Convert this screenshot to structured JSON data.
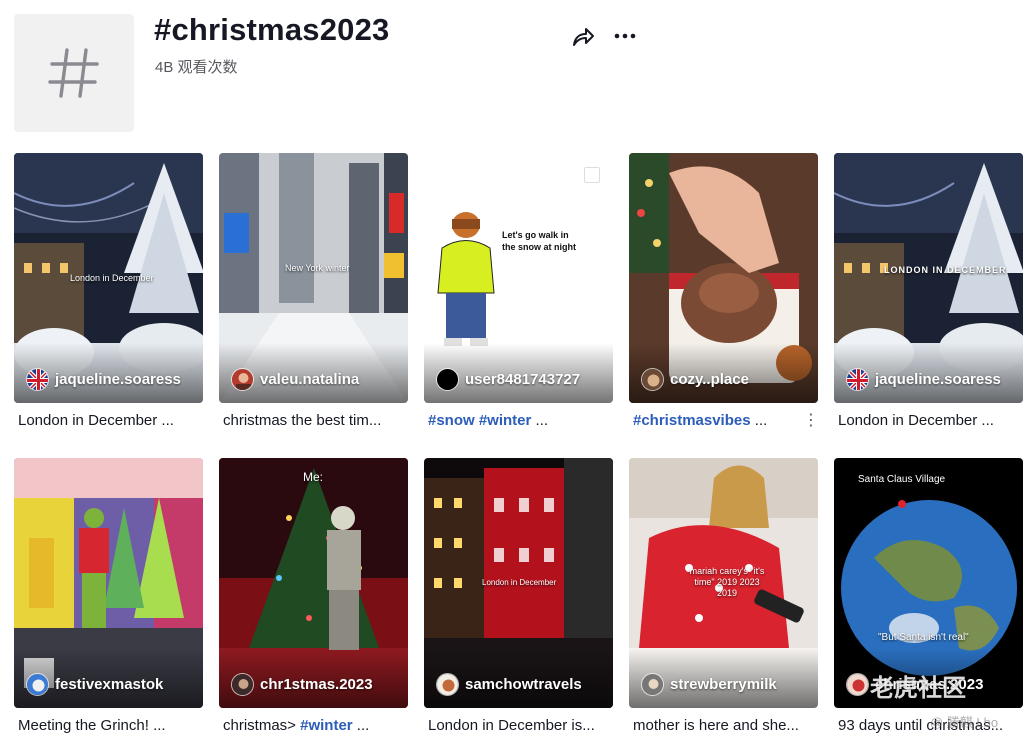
{
  "hashtag": {
    "title": "#christmas2023",
    "views": "4B 观看次数"
  },
  "videos": [
    {
      "author": "jaqueline.soaress",
      "caption": "London in December ...",
      "overlay": "London in December",
      "avatar": "uk-flag-icon"
    },
    {
      "author": "valeu.natalina",
      "caption": "christmas the best tim...",
      "overlay": "New York winter",
      "avatar": "avatar-icon"
    },
    {
      "author": "user8481743727",
      "caption_tags": "#snow #winter",
      "caption_rest": " ...",
      "overlay": "Let's go walk in the snow at night",
      "avatar": "avatar-icon"
    },
    {
      "author": "cozy..place",
      "caption_tags": "#christmasvibes",
      "caption_rest": " ...",
      "avatar": "avatar-icon"
    },
    {
      "author": "jaqueline.soaress",
      "caption": "London in December ...",
      "overlay": "LONDON IN DECEMBER",
      "avatar": "uk-flag-icon"
    },
    {
      "author": "festivexmastok",
      "caption": "Meeting the Grinch! ...",
      "avatar": "avatar-icon"
    },
    {
      "author": "chr1stmas.2023",
      "caption_pre": "christmas> ",
      "caption_tags": "#winter",
      "caption_rest": " ...",
      "overlay": "Me:",
      "avatar": "avatar-icon"
    },
    {
      "author": "samchowtravels",
      "caption": "London in December is...",
      "overlay": "London in December",
      "avatar": "avatar-icon"
    },
    {
      "author": "strewberrymilk",
      "caption": "mother is here and she...",
      "overlay": "mariah carey's \"it's time\" 2019 2023 2019",
      "avatar": "avatar-icon"
    },
    {
      "author": "christmas.2023",
      "caption": "93 days until christmas...",
      "overlay_top": "Santa Claus Village",
      "overlay_bottom": "\"But Santa isn't real\"",
      "avatar": "avatar-icon"
    }
  ],
  "watermark": {
    "main": "老虎社区",
    "sub": "@ 勝麒 Lbo"
  },
  "colors": {
    "text": "#161823",
    "secondary": "#57585e",
    "hashtag_link": "#2b5db9",
    "tile_bg": "#f1f1f2"
  },
  "icons": {
    "share": "share-arrow-icon",
    "more": "more-dots-icon",
    "hashtag": "hashtag-icon",
    "card_menu": "vertical-dots-icon"
  }
}
